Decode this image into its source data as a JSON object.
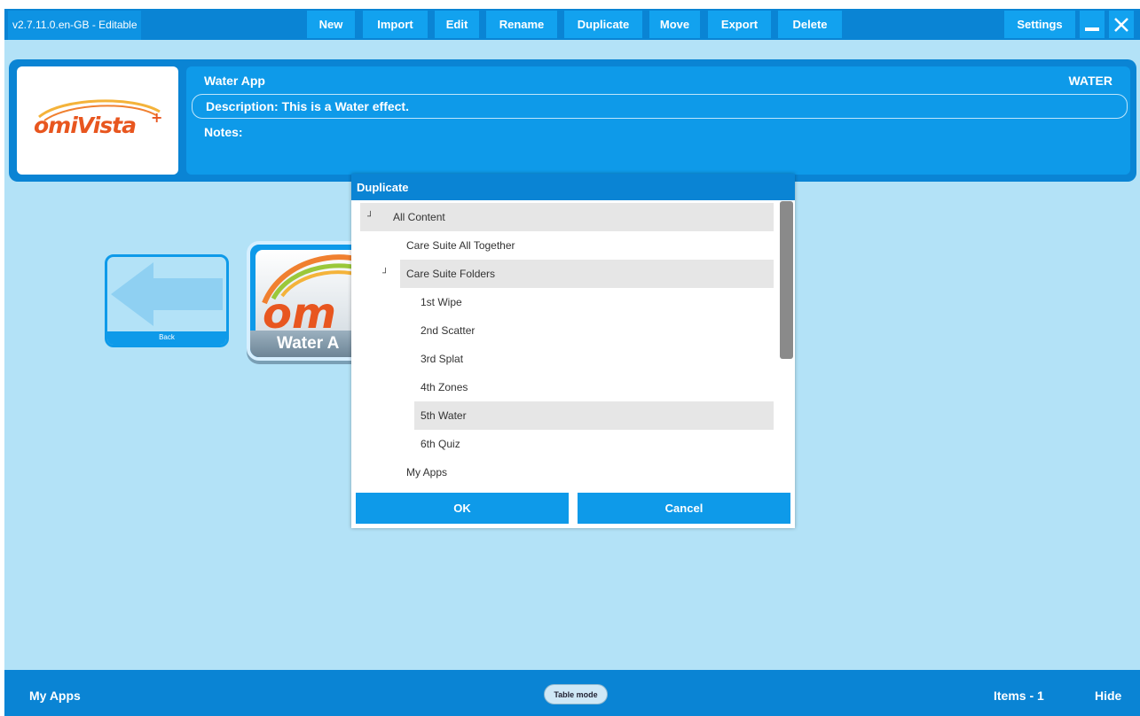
{
  "topbar": {
    "version": "v2.7.11.0.en-GB - Editable",
    "buttons": [
      "New",
      "Import",
      "Edit",
      "Rename",
      "Duplicate",
      "Move",
      "Export",
      "Delete"
    ],
    "settings": "Settings"
  },
  "header": {
    "logo": "omiVista+",
    "title": "Water App",
    "code": "WATER",
    "description": "Description: This is a Water effect.",
    "notes": "Notes:"
  },
  "tiles": {
    "back_label": "Back",
    "app_label": "Water A"
  },
  "dialog": {
    "title": "Duplicate",
    "tree": [
      {
        "label": "All Content",
        "level": 0,
        "expanded": true,
        "selected": true
      },
      {
        "label": "Care Suite All Together",
        "level": 1,
        "expanded": false,
        "selected": false
      },
      {
        "label": "Care Suite Folders",
        "level": 1,
        "expanded": true,
        "selected": true
      },
      {
        "label": "1st Wipe",
        "level": 2,
        "expanded": false,
        "selected": false
      },
      {
        "label": "2nd Scatter",
        "level": 2,
        "expanded": false,
        "selected": false
      },
      {
        "label": "3rd Splat",
        "level": 2,
        "expanded": false,
        "selected": false
      },
      {
        "label": "4th Zones",
        "level": 2,
        "expanded": false,
        "selected": false
      },
      {
        "label": "5th Water",
        "level": 2,
        "expanded": false,
        "selected": true
      },
      {
        "label": "6th Quiz",
        "level": 2,
        "expanded": false,
        "selected": false
      },
      {
        "label": "My Apps",
        "level": 1,
        "expanded": false,
        "selected": false
      }
    ],
    "ok": "OK",
    "cancel": "Cancel"
  },
  "footer": {
    "folder": "My Apps",
    "table_mode": "Table mode",
    "items": "Items - 1",
    "hide": "Hide"
  },
  "colors": {
    "bar": "#0a84d4",
    "button": "#12a2ef",
    "background": "#b3e2f7",
    "logo_orange": "#e8561f"
  }
}
